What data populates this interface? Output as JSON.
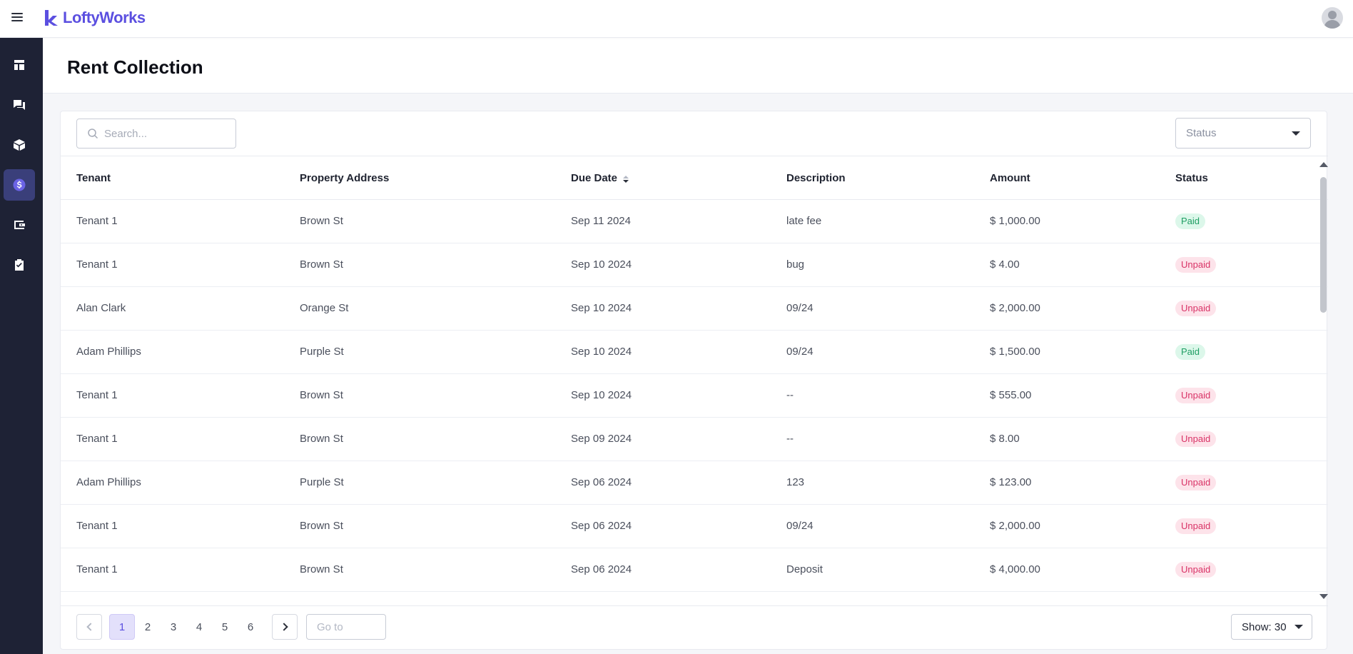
{
  "app": {
    "logo_text": "LoftyWorks"
  },
  "colors": {
    "brand": "#5b4fe0",
    "sidebar_bg": "#1e2235",
    "sidebar_active": "#3a3f7a",
    "paid": "#1f9e63",
    "unpaid": "#d93266"
  },
  "sidebar": {
    "items": [
      {
        "icon": "dashboard-icon",
        "active": false
      },
      {
        "icon": "chat-icon",
        "active": false
      },
      {
        "icon": "box-icon",
        "active": false
      },
      {
        "icon": "dollar-icon",
        "active": true
      },
      {
        "icon": "wallet-icon",
        "active": false
      },
      {
        "icon": "clipboard-check-icon",
        "active": false
      }
    ]
  },
  "header": {
    "title": "Rent Collection"
  },
  "toolbar": {
    "search_placeholder": "Search...",
    "status_placeholder": "Status"
  },
  "table": {
    "columns": [
      "Tenant",
      "Property Address",
      "Due Date",
      "Description",
      "Amount",
      "Status"
    ],
    "sorted_column": "Due Date",
    "sort_direction": "desc",
    "rows": [
      {
        "tenant": "Tenant 1",
        "address": "Brown St",
        "due": "Sep 11 2024",
        "desc": "late fee",
        "amount": "$ 1,000.00",
        "status": "Paid"
      },
      {
        "tenant": "Tenant 1",
        "address": "Brown St",
        "due": "Sep 10 2024",
        "desc": "bug",
        "amount": "$ 4.00",
        "status": "Unpaid"
      },
      {
        "tenant": "Alan Clark",
        "address": "Orange St",
        "due": "Sep 10 2024",
        "desc": "09/24",
        "amount": "$ 2,000.00",
        "status": "Unpaid"
      },
      {
        "tenant": "Adam Phillips",
        "address": "Purple St",
        "due": "Sep 10 2024",
        "desc": "09/24",
        "amount": "$ 1,500.00",
        "status": "Paid"
      },
      {
        "tenant": "Tenant 1",
        "address": "Brown St",
        "due": "Sep 10 2024",
        "desc": "--",
        "amount": "$ 555.00",
        "status": "Unpaid"
      },
      {
        "tenant": "Tenant 1",
        "address": "Brown St",
        "due": "Sep 09 2024",
        "desc": "--",
        "amount": "$ 8.00",
        "status": "Unpaid"
      },
      {
        "tenant": "Adam Phillips",
        "address": "Purple St",
        "due": "Sep 06 2024",
        "desc": "123",
        "amount": "$ 123.00",
        "status": "Unpaid"
      },
      {
        "tenant": "Tenant 1",
        "address": "Brown St",
        "due": "Sep 06 2024",
        "desc": "09/24",
        "amount": "$ 2,000.00",
        "status": "Unpaid"
      },
      {
        "tenant": "Tenant 1",
        "address": "Brown St",
        "due": "Sep 06 2024",
        "desc": "Deposit",
        "amount": "$ 4,000.00",
        "status": "Unpaid"
      }
    ]
  },
  "pagination": {
    "pages": [
      "1",
      "2",
      "3",
      "4",
      "5",
      "6"
    ],
    "current": "1",
    "goto_placeholder": "Go to",
    "page_size_label": "Show: 30"
  }
}
